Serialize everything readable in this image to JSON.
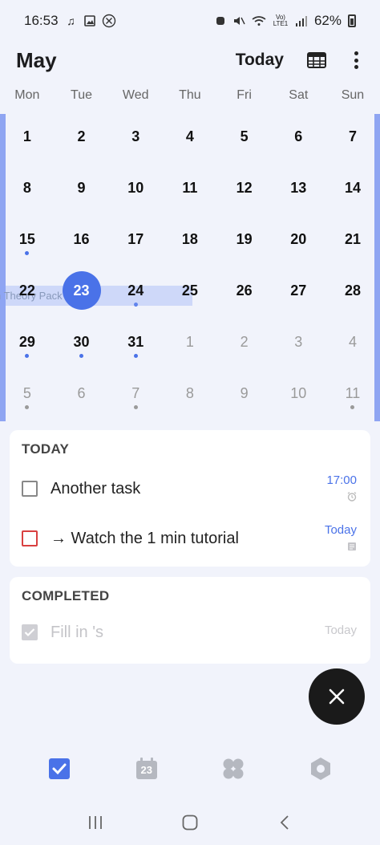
{
  "status_bar": {
    "time": "16:53",
    "battery": "62%"
  },
  "header": {
    "month": "May",
    "today_label": "Today"
  },
  "weekdays": [
    "Mon",
    "Tue",
    "Wed",
    "Thu",
    "Fri",
    "Sat",
    "Sun"
  ],
  "weeks": [
    [
      {
        "d": "1"
      },
      {
        "d": "2"
      },
      {
        "d": "3"
      },
      {
        "d": "4"
      },
      {
        "d": "5"
      },
      {
        "d": "6"
      },
      {
        "d": "7"
      }
    ],
    [
      {
        "d": "8"
      },
      {
        "d": "9"
      },
      {
        "d": "10"
      },
      {
        "d": "11"
      },
      {
        "d": "12"
      },
      {
        "d": "13"
      },
      {
        "d": "14"
      }
    ],
    [
      {
        "d": "15",
        "dot": true
      },
      {
        "d": "16"
      },
      {
        "d": "17"
      },
      {
        "d": "18"
      },
      {
        "d": "19"
      },
      {
        "d": "20"
      },
      {
        "d": "21"
      }
    ],
    [
      {
        "d": "22"
      },
      {
        "d": "23",
        "selected": true
      },
      {
        "d": "24",
        "dot": true
      },
      {
        "d": "25"
      },
      {
        "d": "26"
      },
      {
        "d": "27"
      },
      {
        "d": "28"
      }
    ],
    [
      {
        "d": "29",
        "dot": true
      },
      {
        "d": "30",
        "dot": true
      },
      {
        "d": "31",
        "dot": true
      },
      {
        "d": "1",
        "faded": true
      },
      {
        "d": "2",
        "faded": true
      },
      {
        "d": "3",
        "faded": true
      },
      {
        "d": "4",
        "faded": true
      }
    ],
    [
      {
        "d": "5",
        "faded": true,
        "dot": true
      },
      {
        "d": "6",
        "faded": true
      },
      {
        "d": "7",
        "faded": true,
        "dot": true
      },
      {
        "d": "8",
        "faded": true
      },
      {
        "d": "9",
        "faded": true
      },
      {
        "d": "10",
        "faded": true
      },
      {
        "d": "11",
        "faded": true,
        "dot": true
      }
    ]
  ],
  "event_bar_text": "n Theory Pack",
  "today_section": {
    "title": "TODAY",
    "tasks": [
      {
        "text": "Another task",
        "date": "17:00",
        "meta_icon": "alarm-icon"
      },
      {
        "text": "→ Watch the 1 min tutorial",
        "date": "Today",
        "meta_icon": "note-icon"
      }
    ]
  },
  "completed_section": {
    "title": "COMPLETED",
    "tasks": [
      {
        "text": "Fill in 's",
        "date": "Today"
      }
    ]
  },
  "bottom_nav": {
    "calendar_day": "23"
  },
  "colors": {
    "accent": "#4a72e8",
    "background": "#f1f3fb",
    "fab": "#1a1a1a",
    "priority_red": "#d94040"
  }
}
